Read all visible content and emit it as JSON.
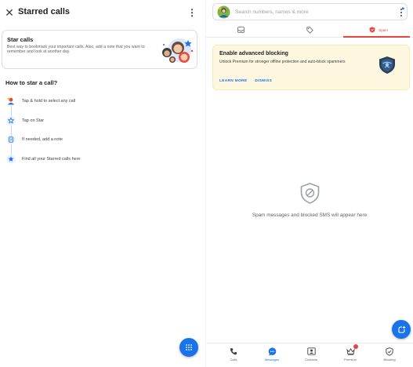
{
  "left": {
    "title": "Starred calls",
    "star_card": {
      "title": "Star calls",
      "description": "Best way to bookmark your important calls. Also, add a note that you want to remember and look at another day."
    },
    "how_title": "How to star a call?",
    "steps": [
      {
        "label": "Tap & hold to select any call",
        "icon": "avatar-icon"
      },
      {
        "label": "Tap on Star",
        "icon": "star-outline-icon"
      },
      {
        "label": "If needed, add a note",
        "icon": "note-icon"
      },
      {
        "label": "Find all your Starred calls here",
        "icon": "star-filled-icon"
      }
    ]
  },
  "right": {
    "search": {
      "placeholder": "Search numbers, names & more"
    },
    "tabs": [
      {
        "name": "inbox-icon"
      },
      {
        "name": "tag-icon"
      },
      {
        "label": "Spam",
        "icon": "shield-icon",
        "active": true
      }
    ],
    "blocking_card": {
      "title": "Enable advanced blocking",
      "description": "Unlock Premium for stronger offline protection and auto-block spammers",
      "learn_more": "LEARN MORE",
      "dismiss": "DISMISS"
    },
    "empty_text": "Spam messages and blocked SMS will appear here",
    "nav": [
      {
        "label": "Calls",
        "icon": "phone-icon"
      },
      {
        "label": "Messages",
        "icon": "chat-icon",
        "active": true
      },
      {
        "label": "Contacts",
        "icon": "contacts-icon"
      },
      {
        "label": "Premium",
        "icon": "crown-icon",
        "badge": true
      },
      {
        "label": "Blocking",
        "icon": "shield-check-icon"
      }
    ]
  },
  "colors": {
    "accent": "#1a73e8",
    "spam_red": "#e8453c",
    "card_yellow": "#fef7e0",
    "text_primary": "#202124",
    "text_secondary": "#5f6368"
  }
}
